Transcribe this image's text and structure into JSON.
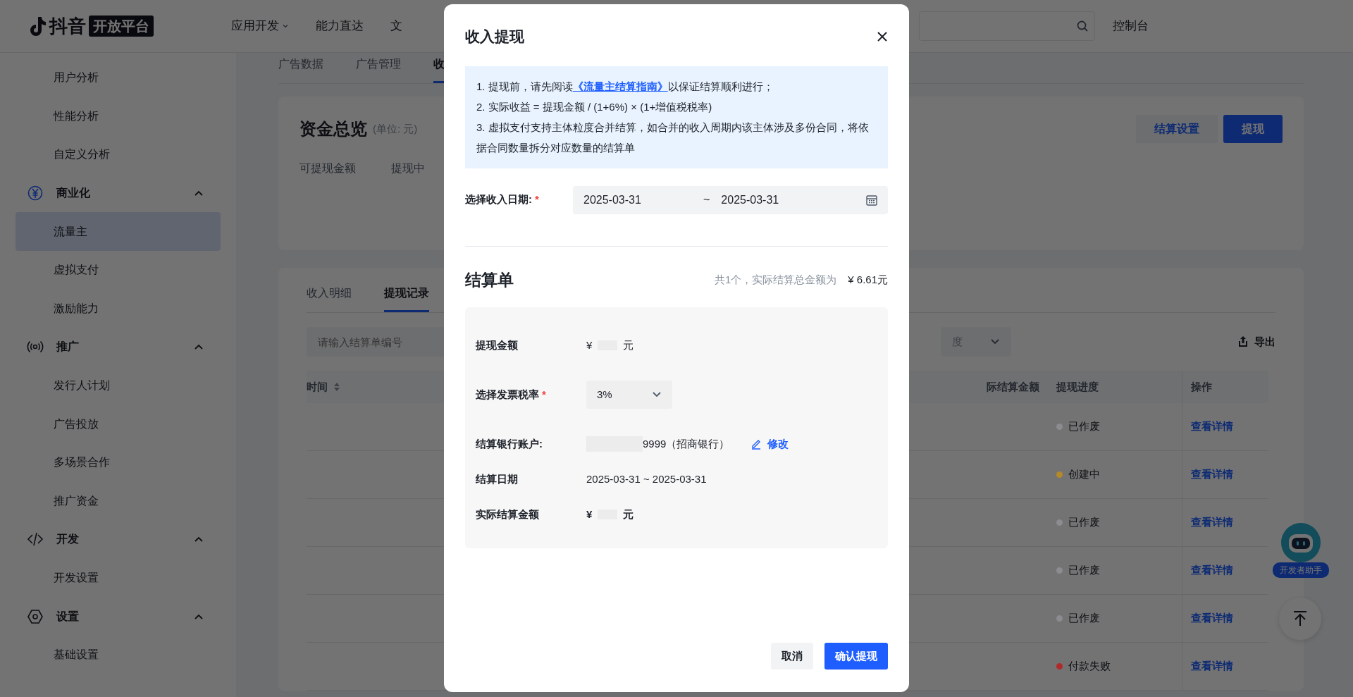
{
  "top_nav": {
    "logo_text": "抖音",
    "logo_badge": "开放平台",
    "menu": [
      {
        "label": "应用开发",
        "has_dropdown": true
      },
      {
        "label": "能力直达",
        "has_dropdown": false
      },
      {
        "label": "文",
        "has_dropdown": false
      }
    ],
    "console_link": "控制台"
  },
  "sidebar": {
    "items": [
      {
        "kind": "item",
        "label": "用户分析",
        "selected": false
      },
      {
        "kind": "item",
        "label": "性能分析",
        "selected": false
      },
      {
        "kind": "item",
        "label": "自定义分析",
        "selected": false
      },
      {
        "kind": "group",
        "label": "商业化",
        "expanded": true,
        "children": [
          {
            "kind": "item",
            "label": "流量主",
            "selected": true
          },
          {
            "kind": "item",
            "label": "虚拟支付",
            "selected": false
          },
          {
            "kind": "item",
            "label": "激励能力",
            "selected": false
          }
        ]
      },
      {
        "kind": "group",
        "label": "推广",
        "expanded": true,
        "children": [
          {
            "kind": "item",
            "label": "发行人计划",
            "selected": false
          },
          {
            "kind": "item",
            "label": "广告投放",
            "selected": false
          },
          {
            "kind": "item",
            "label": "多场景合作",
            "selected": false
          },
          {
            "kind": "item",
            "label": "推广资金",
            "selected": false
          }
        ]
      },
      {
        "kind": "group",
        "label": "开发",
        "expanded": true,
        "children": [
          {
            "kind": "item",
            "label": "开发设置",
            "selected": false
          }
        ]
      },
      {
        "kind": "group",
        "label": "设置",
        "expanded": true,
        "children": [
          {
            "kind": "item",
            "label": "基础设置",
            "selected": false
          }
        ]
      }
    ]
  },
  "sub_tabs": [
    {
      "label": "广告数据",
      "selected": false
    },
    {
      "label": "广告管理",
      "selected": false
    },
    {
      "label": "收",
      "selected": true
    }
  ],
  "overview": {
    "title": "资金总览",
    "unit": "(单位: 元)",
    "metrics": [
      "可提现金额",
      "提现中"
    ],
    "buttons": [
      {
        "label": "结算设置",
        "kind": "secondary"
      },
      {
        "label": "提现",
        "kind": "primary"
      }
    ]
  },
  "records": {
    "tabs": [
      {
        "label": "收入明细",
        "selected": false
      },
      {
        "label": "提现记录",
        "selected": true
      }
    ],
    "search": {
      "placeholder": "请输入结算单编号"
    },
    "filter_value": "度",
    "export_label": "导出",
    "columns": [
      "时间",
      "际结算金额",
      "提现进度",
      "操作"
    ],
    "rows": [
      {
        "status": "已作废",
        "color": "#8a8c90",
        "action": "查看详情"
      },
      {
        "status": "创建中",
        "color": "#b3892a",
        "action": "查看详情"
      },
      {
        "status": "已作废",
        "color": "#8a8c90",
        "action": "查看详情"
      },
      {
        "status": "已作废",
        "color": "#8a8c90",
        "action": "查看详情"
      },
      {
        "status": "已作废",
        "color": "#8a8c90",
        "action": "查看详情"
      },
      {
        "status": "付款失败",
        "color": "#b02a2a",
        "action": "查看详情"
      }
    ]
  },
  "assistant": {
    "label": "开发者助手"
  },
  "modal": {
    "title": "收入提现",
    "notes": [
      {
        "before": "1. 提现前，请先阅读",
        "link": "《流量主结算指南》",
        "after": "以保证结算顺利进行；"
      },
      {
        "before": "2. 实际收益 = 提现金额 / (1+6%) × (1+增值税税率)"
      },
      {
        "before": "3. 虚拟支付支持主体粒度合并结算，如合并的收入周期内该主体涉及多份合同，将依据合同数量拆分对应数量的结算单"
      }
    ],
    "date_field": {
      "label": "选择收入日期:",
      "required_mark": "*",
      "start": "2025-03-31",
      "separator": "~",
      "end": "2025-03-31"
    },
    "statement": {
      "title": "结算单",
      "summary": "共1个，实际结算总金额为",
      "total": "¥ 6.61元",
      "rows": [
        {
          "kind": "amount",
          "label": "提现金额",
          "currency": "¥",
          "suffix": "元",
          "bold": false
        },
        {
          "kind": "select",
          "label": "选择发票税率",
          "required_mark": "*",
          "value": "3%"
        },
        {
          "kind": "bank",
          "label": "结算银行账户:",
          "value": "9999（招商银行）",
          "edit_label": "修改"
        },
        {
          "kind": "text",
          "label": "结算日期",
          "value": "2025-03-31 ~ 2025-03-31"
        },
        {
          "kind": "amount",
          "label": "实际结算金额",
          "currency": "¥",
          "suffix": "元",
          "bold": true
        }
      ]
    },
    "buttons": [
      {
        "label": "取消",
        "kind": "secondary"
      },
      {
        "label": "确认提现",
        "kind": "primary"
      }
    ]
  }
}
